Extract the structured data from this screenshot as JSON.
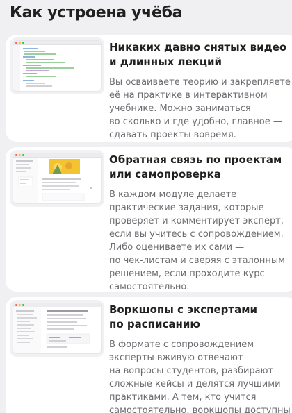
{
  "section": {
    "title": "Как устроена учёба"
  },
  "cards": [
    {
      "title_lines": [
        "Никаких давно снятых видео",
        "и длинных лекций"
      ],
      "desc_lines": [
        "Вы осваиваете теорию и закрепляете",
        "её на практике в интерактивном",
        "учебнике. Можно заниматься",
        "во сколько и где удобно, главное —",
        "сдавать проекты вовремя."
      ],
      "screenshot": "code-editor-screenshot"
    },
    {
      "title_lines": [
        "Обратная связь по проектам",
        "или самопроверка"
      ],
      "desc_lines": [
        "В каждом модуле делаете",
        "практические задания, которые",
        "проверяет и комментирует эксперт,",
        "если вы учитесь с сопровождением.",
        "Либо оцениваете их сами —",
        "по чек-листам и сверяя с эталонным",
        "решением, если проходите курс",
        "самостоятельно."
      ],
      "screenshot": "project-review-screenshot"
    },
    {
      "title_lines": [
        "Воркшопы с экспертами",
        "по расписанию"
      ],
      "desc_lines": [
        "В формате с сопровождением",
        "эксперты вживую отвечают",
        "на вопросы студентов, разбирают",
        "сложные кейсы и делятся лучшими",
        "практиками. А тем, кто учится",
        "самостоятельно, воркшопы доступны"
      ],
      "screenshot": "workshop-schedule-screenshot"
    }
  ],
  "colors": {
    "background": "#f0f0f3",
    "card": "#ffffff",
    "title": "#21201f",
    "description": "#6c6b70",
    "accent_yellow": "#f4c430",
    "accent_green": "#7fc38f"
  }
}
